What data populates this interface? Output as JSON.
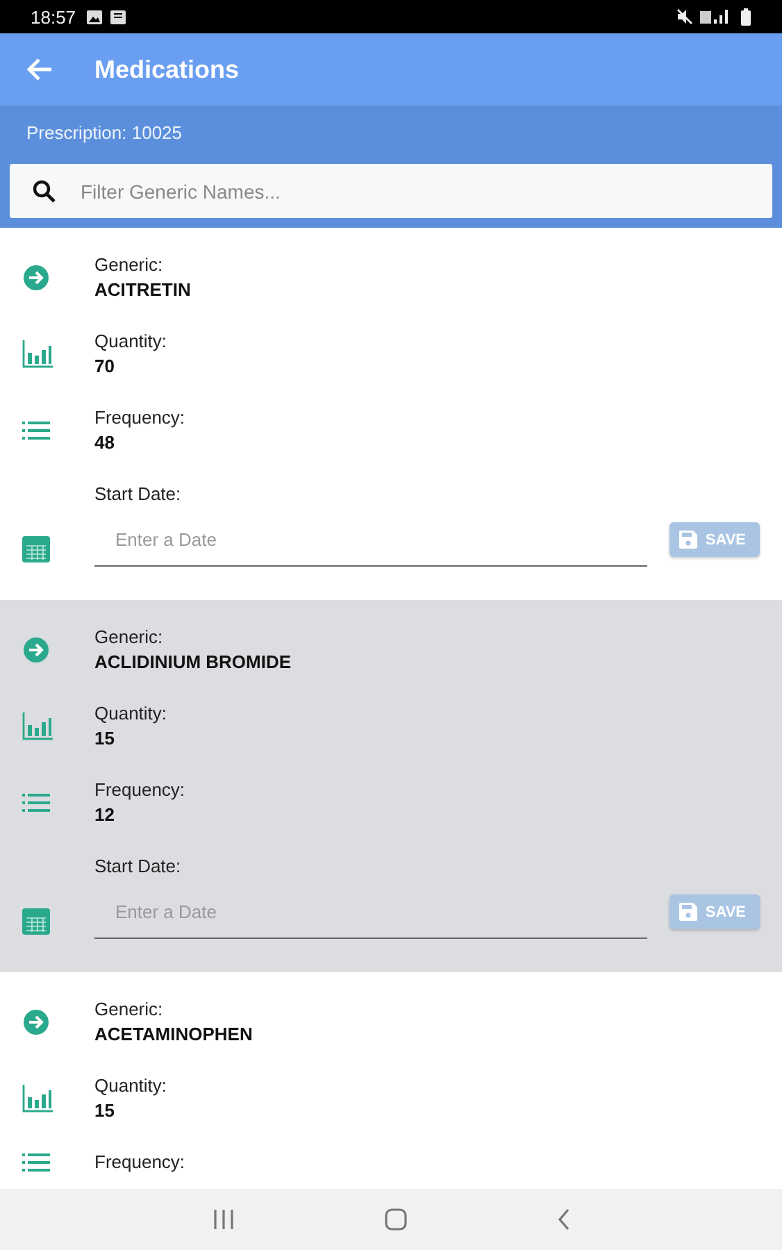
{
  "status_bar": {
    "time": "18:57"
  },
  "app_bar": {
    "title": "Medications"
  },
  "prescription": "Prescription: 10025",
  "search": {
    "placeholder": "Filter Generic Names..."
  },
  "medications": [
    {
      "selected": false,
      "fields": [
        {
          "kind": "generic",
          "label": "Generic:",
          "value": "ACITRETIN"
        },
        {
          "kind": "quantity",
          "label": "Quantity:",
          "value": "70"
        },
        {
          "kind": "frequency",
          "label": "Frequency:",
          "value": "48"
        },
        {
          "kind": "date",
          "label": "Start Date:",
          "placeholder": "Enter a Date",
          "button": "SAVE"
        }
      ]
    },
    {
      "selected": true,
      "fields": [
        {
          "kind": "generic",
          "label": "Generic:",
          "value": "ACLIDINIUM BROMIDE"
        },
        {
          "kind": "quantity",
          "label": "Quantity:",
          "value": "15"
        },
        {
          "kind": "frequency",
          "label": "Frequency:",
          "value": "12"
        },
        {
          "kind": "date",
          "label": "Start Date:",
          "placeholder": "Enter a Date",
          "button": "SAVE"
        }
      ]
    },
    {
      "selected": false,
      "fields": [
        {
          "kind": "generic",
          "label": "Generic:",
          "value": "ACETAMINOPHEN"
        },
        {
          "kind": "quantity",
          "label": "Quantity:",
          "value": "15"
        },
        {
          "kind": "frequency",
          "label": "Frequency:"
        }
      ]
    }
  ]
}
